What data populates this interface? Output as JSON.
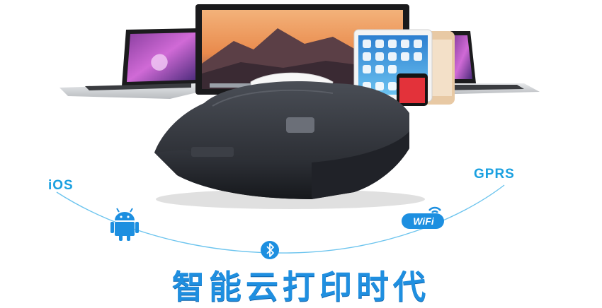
{
  "labels": {
    "ios": "iOS",
    "gprs": "GPRS",
    "wifi": "WiFi"
  },
  "headline": "智能云打印时代",
  "icons": [
    "laptop-icon",
    "monitor-icon",
    "tablet-icon",
    "phone-icon",
    "receipt-printer-icon",
    "android-icon",
    "bluetooth-icon",
    "wifi-badge-icon"
  ],
  "colors": {
    "accent": "#1aa0e0",
    "headline": "#1f8fe0",
    "printer_body": "#2a2d33"
  }
}
